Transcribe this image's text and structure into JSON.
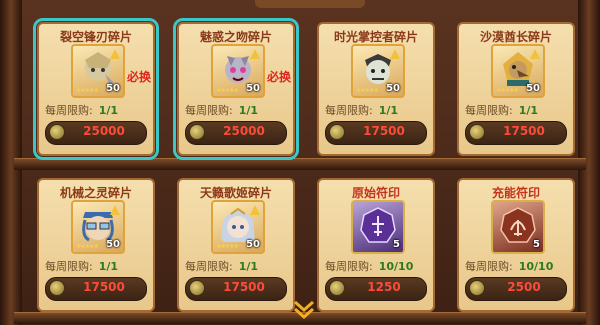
{
  "top_tab": "",
  "limit_label": "每周限购:",
  "items": [
    {
      "name": "裂空锋刃碎片",
      "qty": "50",
      "limit": "1/1",
      "price": "25000",
      "must": "必换",
      "selected": true,
      "kind": "hero"
    },
    {
      "name": "魅惑之吻碎片",
      "qty": "50",
      "limit": "1/1",
      "price": "25000",
      "must": "必换",
      "selected": true,
      "kind": "hero"
    },
    {
      "name": "时光掌控者碎片",
      "qty": "50",
      "limit": "1/1",
      "price": "17500",
      "must": "",
      "selected": false,
      "kind": "hero"
    },
    {
      "name": "沙漠酋长碎片",
      "qty": "50",
      "limit": "1/1",
      "price": "17500",
      "must": "",
      "selected": false,
      "kind": "hero"
    },
    {
      "name": "机械之灵碎片",
      "qty": "50",
      "limit": "1/1",
      "price": "17500",
      "must": "",
      "selected": false,
      "kind": "hero"
    },
    {
      "name": "天籁歌姬碎片",
      "qty": "50",
      "limit": "1/1",
      "price": "17500",
      "must": "",
      "selected": false,
      "kind": "hero"
    },
    {
      "name": "原始符印",
      "qty": "5",
      "limit": "10/10",
      "price": "1250",
      "must": "",
      "selected": false,
      "kind": "rune-purple"
    },
    {
      "name": "充能符印",
      "qty": "5",
      "limit": "10/10",
      "price": "2500",
      "must": "",
      "selected": false,
      "kind": "rune-red"
    }
  ],
  "colors": {
    "highlight": "#3ac7c9",
    "price": "#ff4a3a",
    "limit_count": "#2d7a1a"
  }
}
